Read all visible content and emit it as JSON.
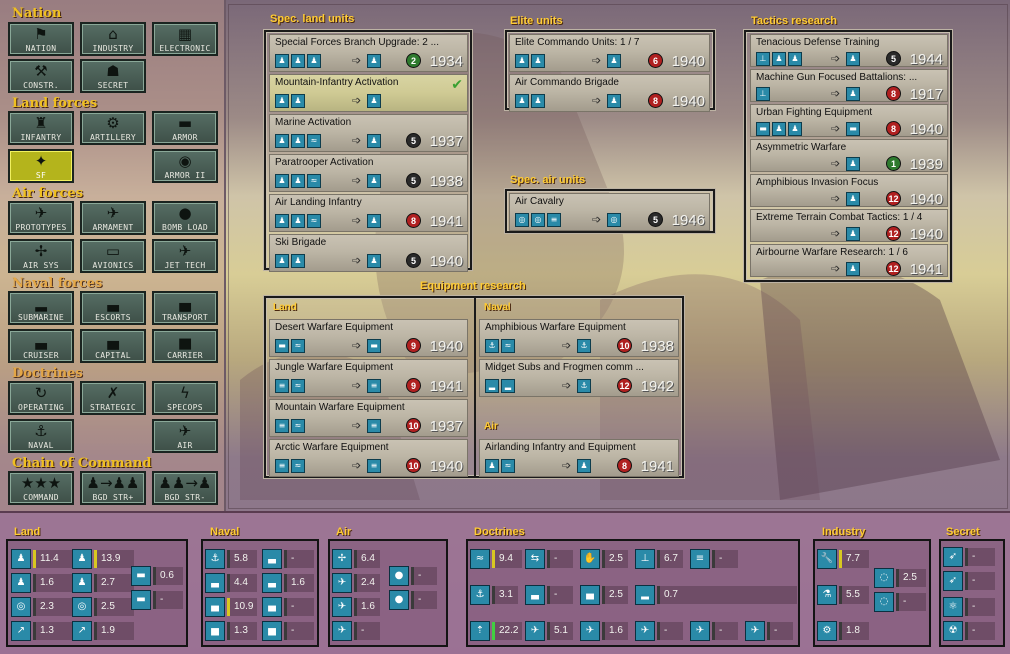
{
  "sidebar": {
    "nation": {
      "title": "Nation",
      "buttons": [
        "NATION",
        "INDUSTRY",
        "ELECTRONIC",
        "CONSTR.",
        "SECRET"
      ]
    },
    "land": {
      "title": "Land forces",
      "buttons": [
        "INFANTRY",
        "ARTILLERY",
        "ARMOR",
        "SF",
        "ARMOR II"
      ]
    },
    "air": {
      "title": "Air forces",
      "buttons": [
        "PROTOTYPES",
        "ARMAMENT",
        "BOMB LOAD",
        "AIR SYS",
        "AVIONICS",
        "JET TECH"
      ]
    },
    "naval": {
      "title": "Naval forces",
      "buttons": [
        "SUBMARINE",
        "ESCORTS",
        "TRANSPORT",
        "CRUISER",
        "CAPITAL",
        "CARRIER"
      ]
    },
    "doctrines": {
      "title": "Doctrines",
      "buttons": [
        "OPERATING",
        "STRATEGIC",
        "SPECOPS",
        "NAVAL",
        "AIR"
      ]
    },
    "chain": {
      "title": "Chain of Command",
      "buttons": [
        "COMMAND",
        "BGD STR+",
        "BGD STR-"
      ]
    }
  },
  "sections": {
    "spec_land": "Spec. land units",
    "elite": "Elite units",
    "tactics": "Tactics research",
    "spec_air": "Spec. air units",
    "equipment": "Equipment research",
    "eq_land": "Land",
    "eq_naval": "Naval",
    "eq_air": "Air"
  },
  "spec_land_units": [
    {
      "name": "Special Forces Branch Upgrade: 2 ...",
      "dot": "2",
      "dot_color": "#2e7a2e",
      "year": "1934"
    },
    {
      "name": "Mountain-Infantry Activation",
      "done": true
    },
    {
      "name": "Marine Activation",
      "dot": "5",
      "dot_color": "#2a2a2a",
      "year": "1937"
    },
    {
      "name": "Paratrooper Activation",
      "dot": "5",
      "dot_color": "#2a2a2a",
      "year": "1938"
    },
    {
      "name": "Air Landing Infantry",
      "dot": "8",
      "dot_color": "#b02020",
      "year": "1941"
    },
    {
      "name": "Ski Brigade",
      "dot": "5",
      "dot_color": "#2a2a2a",
      "year": "1940"
    }
  ],
  "elite_units": [
    {
      "name": "Elite Commando Units: 1 / 7",
      "dot": "6",
      "dot_color": "#b02020",
      "year": "1940"
    },
    {
      "name": "Air Commando Brigade",
      "dot": "8",
      "dot_color": "#b02020",
      "year": "1940"
    }
  ],
  "spec_air_units": [
    {
      "name": "Air Cavalry",
      "dot": "5",
      "dot_color": "#2a2a2a",
      "year": "1946"
    }
  ],
  "tactics": [
    {
      "name": "Tenacious Defense Training",
      "dot": "5",
      "dot_color": "#2a2a2a",
      "year": "1944"
    },
    {
      "name": "Machine Gun Focused Battalions: ...",
      "dot": "8",
      "dot_color": "#b02020",
      "year": "1917"
    },
    {
      "name": "Urban Fighting Equipment",
      "dot": "8",
      "dot_color": "#b02020",
      "year": "1940"
    },
    {
      "name": "Asymmetric Warfare",
      "dot": "1",
      "dot_color": "#2e7a2e",
      "year": "1939"
    },
    {
      "name": "Amphibious Invasion Focus",
      "dot": "12",
      "dot_color": "#b02020",
      "year": "1940"
    },
    {
      "name": "Extreme Terrain Combat Tactics: 1 / 4",
      "dot": "12",
      "dot_color": "#b02020",
      "year": "1940"
    },
    {
      "name": "Airbourne Warfare Research: 1 / 6",
      "dot": "12",
      "dot_color": "#b02020",
      "year": "1941"
    }
  ],
  "equip_land": [
    {
      "name": "Desert Warfare Equipment",
      "dot": "9",
      "dot_color": "#b02020",
      "year": "1940"
    },
    {
      "name": "Jungle Warfare Equipment",
      "dot": "9",
      "dot_color": "#b02020",
      "year": "1941"
    },
    {
      "name": "Mountain Warfare Equipment",
      "dot": "10",
      "dot_color": "#b02020",
      "year": "1937"
    },
    {
      "name": "Arctic Warfare Equipment",
      "dot": "10",
      "dot_color": "#b02020",
      "year": "1940"
    }
  ],
  "equip_naval": [
    {
      "name": "Amphibious Warfare Equipment",
      "dot": "10",
      "dot_color": "#b02020",
      "year": "1938"
    },
    {
      "name": "Midget Subs and Frogmen comm ...",
      "dot": "12",
      "dot_color": "#b02020",
      "year": "1942"
    }
  ],
  "equip_air": [
    {
      "name": "Airlanding Infantry and Equipment",
      "dot": "8",
      "dot_color": "#b02020",
      "year": "1941"
    }
  ],
  "bottom": {
    "headers": {
      "land": "Land",
      "naval": "Naval",
      "air": "Air",
      "doctrines": "Doctrines",
      "industry": "Industry",
      "secret": "Secret"
    },
    "land": [
      "11.4",
      "13.9",
      "1.6",
      "2.7",
      "2.3",
      "2.5",
      "1.3",
      "1.9",
      "0.6",
      "-"
    ],
    "naval": [
      "5.8",
      "-",
      "4.4",
      "1.6",
      "10.9",
      "-",
      "1.3",
      "-"
    ],
    "air": [
      "6.4",
      "-",
      "2.4",
      "-",
      "1.6",
      "-",
      "-"
    ],
    "doctrines": [
      "9.4",
      "-",
      "2.5",
      "6.7",
      "-",
      "3.1",
      "-",
      "2.5",
      "0.7",
      "22.2",
      "5.1",
      "1.6",
      "-",
      "-",
      "-"
    ],
    "industry": [
      "7.7",
      "2.5",
      "5.5",
      "-",
      "1.8"
    ],
    "secret": [
      "-",
      "-",
      "-",
      "-"
    ]
  }
}
